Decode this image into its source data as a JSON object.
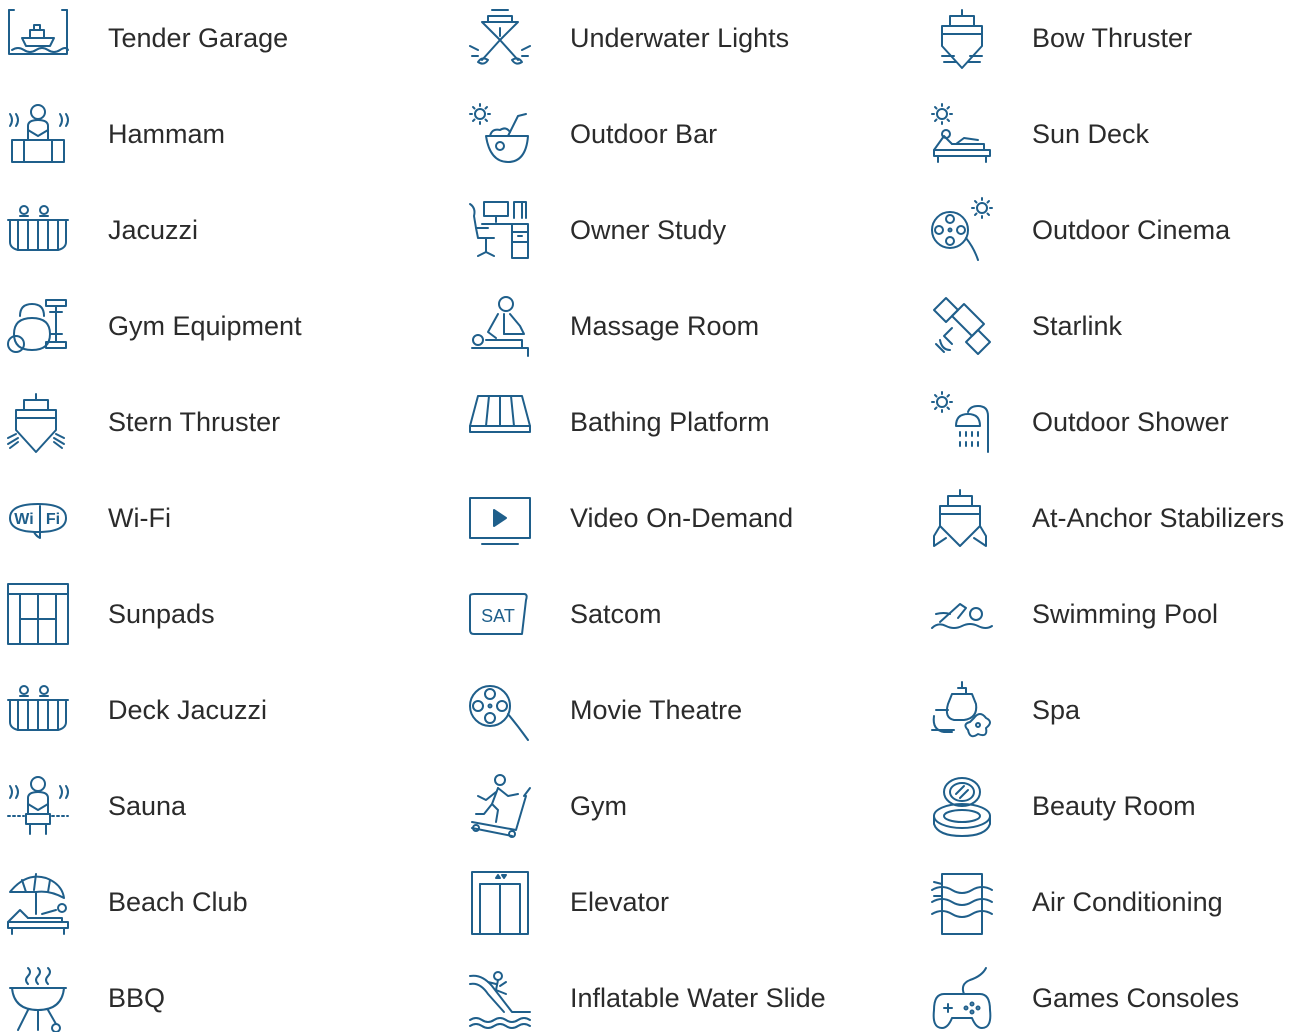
{
  "colors": {
    "icon": "#1f5f8b",
    "text": "#2b2b2b",
    "background": "#ffffff"
  },
  "amenities": [
    {
      "label": "Tender Garage",
      "icon": "tender-garage-icon"
    },
    {
      "label": "Underwater Lights",
      "icon": "underwater-lights-icon"
    },
    {
      "label": "Bow Thruster",
      "icon": "bow-thruster-icon"
    },
    {
      "label": "Hammam",
      "icon": "hammam-icon"
    },
    {
      "label": "Outdoor Bar",
      "icon": "outdoor-bar-icon"
    },
    {
      "label": "Sun Deck",
      "icon": "sun-deck-icon"
    },
    {
      "label": "Jacuzzi",
      "icon": "jacuzzi-icon"
    },
    {
      "label": "Owner Study",
      "icon": "owner-study-icon"
    },
    {
      "label": "Outdoor Cinema",
      "icon": "outdoor-cinema-icon"
    },
    {
      "label": "Gym Equipment",
      "icon": "gym-equipment-icon"
    },
    {
      "label": "Massage Room",
      "icon": "massage-room-icon"
    },
    {
      "label": "Starlink",
      "icon": "starlink-icon"
    },
    {
      "label": "Stern Thruster",
      "icon": "stern-thruster-icon"
    },
    {
      "label": "Bathing Platform",
      "icon": "bathing-platform-icon"
    },
    {
      "label": "Outdoor Shower",
      "icon": "outdoor-shower-icon"
    },
    {
      "label": "Wi-Fi",
      "icon": "wifi-icon",
      "icon_text_1": "Wi",
      "icon_text_2": "Fi"
    },
    {
      "label": "Video On-Demand",
      "icon": "video-on-demand-icon"
    },
    {
      "label": "At-Anchor Stabilizers",
      "icon": "at-anchor-stabilizers-icon"
    },
    {
      "label": "Sunpads",
      "icon": "sunpads-icon"
    },
    {
      "label": "Satcom",
      "icon": "satcom-icon",
      "icon_text_1": "SAT"
    },
    {
      "label": "Swimming Pool",
      "icon": "swimming-pool-icon"
    },
    {
      "label": "Deck Jacuzzi",
      "icon": "deck-jacuzzi-icon"
    },
    {
      "label": "Movie Theatre",
      "icon": "movie-theatre-icon"
    },
    {
      "label": "Spa",
      "icon": "spa-icon"
    },
    {
      "label": "Sauna",
      "icon": "sauna-icon"
    },
    {
      "label": "Gym",
      "icon": "gym-icon"
    },
    {
      "label": "Beauty Room",
      "icon": "beauty-room-icon"
    },
    {
      "label": "Beach Club",
      "icon": "beach-club-icon"
    },
    {
      "label": "Elevator",
      "icon": "elevator-icon"
    },
    {
      "label": "Air Conditioning",
      "icon": "air-conditioning-icon"
    },
    {
      "label": "BBQ",
      "icon": "bbq-icon"
    },
    {
      "label": "Inflatable Water Slide",
      "icon": "inflatable-water-slide-icon"
    },
    {
      "label": "Games Consoles",
      "icon": "games-consoles-icon"
    }
  ]
}
